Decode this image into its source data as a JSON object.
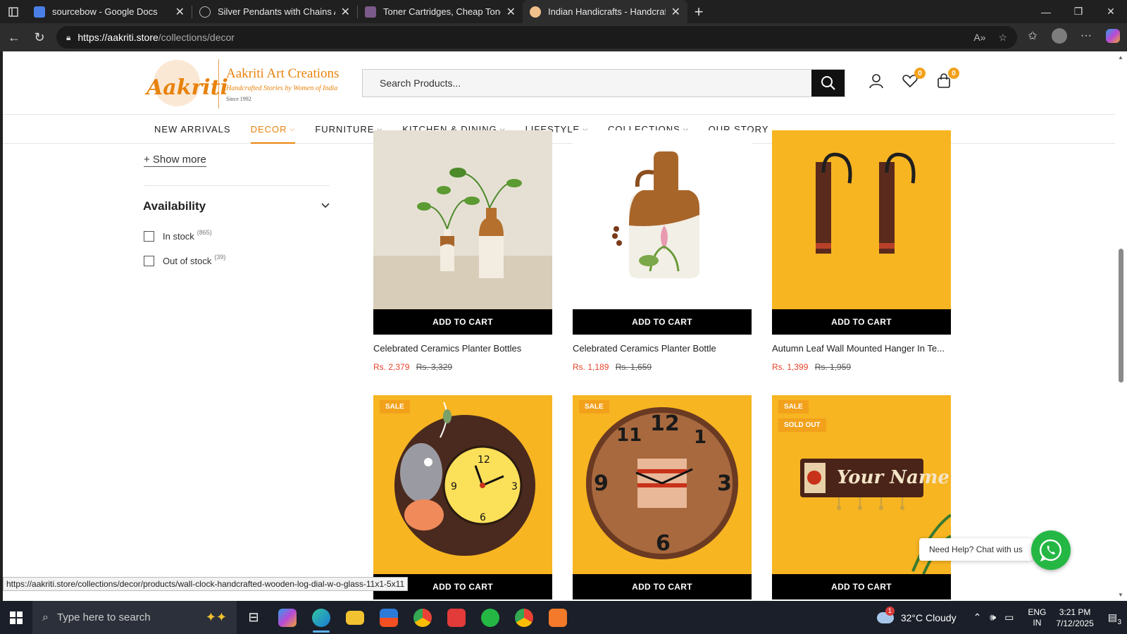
{
  "browser": {
    "tabs": [
      {
        "title": "sourcebow - Google Docs",
        "color": "#4a7fe8",
        "active": false
      },
      {
        "title": "Silver Pendants with Chains Archi",
        "color": "#888888",
        "active": false
      },
      {
        "title": "Toner Cartridges, Cheap Toner Ca",
        "color": "#7a5a8a",
        "active": false
      },
      {
        "title": "Indian Handicrafts - Handcrafted",
        "color": "#f0c08a",
        "active": true
      }
    ],
    "url_host": "https://aakriti.store",
    "url_path": "/collections/decor"
  },
  "site": {
    "logo_name": "Aakriti Art Creations",
    "logo_tagline": "Handcrafted Stories by Women of India",
    "logo_since": "Since 1992",
    "logo_mark": "Aakriti",
    "search_placeholder": "Search Products...",
    "wishlist_count": "0",
    "cart_count": "0",
    "nav": [
      {
        "label": "NEW ARRIVALS",
        "dropdown": false,
        "active": false
      },
      {
        "label": "DECOR",
        "dropdown": true,
        "active": true
      },
      {
        "label": "FURNITURE",
        "dropdown": true,
        "active": false
      },
      {
        "label": "KITCHEN & DINING",
        "dropdown": true,
        "active": false
      },
      {
        "label": "LIFESTYLE",
        "dropdown": true,
        "active": false
      },
      {
        "label": "COLLECTIONS",
        "dropdown": true,
        "active": false
      },
      {
        "label": "OUR STORY",
        "dropdown": false,
        "active": false
      }
    ],
    "accent": "#e8820c"
  },
  "sidebar": {
    "show_more": "+ Show more",
    "availability_title": "Availability",
    "filters": [
      {
        "label": "In stock",
        "count": "(865)"
      },
      {
        "label": "Out of stock",
        "count": "(39)"
      }
    ]
  },
  "products": {
    "add_to_cart": "ADD TO CART",
    "sale_label": "SALE",
    "sold_out_label": "SOLD OUT",
    "items": [
      {
        "title": "Celebrated Ceramics Planter Bottles",
        "price": "Rs. 2,379",
        "compare": "Rs. 3,329"
      },
      {
        "title": "Celebrated Ceramics Planter Bottle",
        "price": "Rs. 1,189",
        "compare": "Rs. 1,659"
      },
      {
        "title": "Autumn Leaf Wall Mounted Hanger In Te...",
        "price": "Rs. 1,399",
        "compare": "Rs. 1,959"
      }
    ],
    "nameplate_text": "Your Name"
  },
  "chat": {
    "label": "Need Help? Chat with us"
  },
  "status_url": "https://aakriti.store/collections/decor/products/wall-clock-handcrafted-wooden-log-dial-w-o-glass-11x1-5x11",
  "taskbar": {
    "search_placeholder": "Type here to search",
    "weather": "32°C  Cloudy",
    "weather_alert": "1",
    "lang1": "ENG",
    "lang2": "IN",
    "time": "3:21 PM",
    "date": "7/12/2025",
    "notifications": "3"
  }
}
